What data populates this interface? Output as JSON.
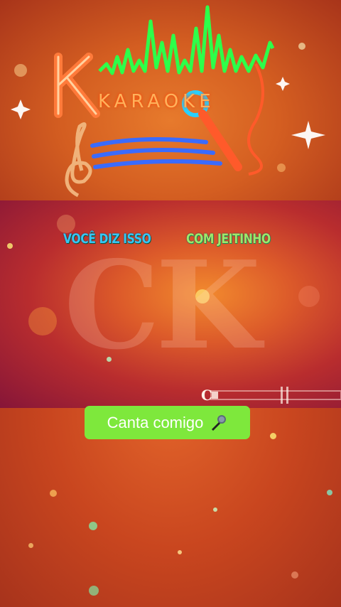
{
  "logo": {
    "title": "KARAOKE",
    "title_color": "#ff5a2a",
    "wave_color": "#2dff4a",
    "staff_color": "#3a6bff"
  },
  "lyrics": {
    "sung": "VOCÊ DIZ ISSO",
    "upcoming": "COM JEITINHO",
    "sung_color": "#37c6f2",
    "upcoming_color": "#9ee86a"
  },
  "watermark": {
    "text": "CK"
  },
  "progress": {
    "fraction": 0.05
  },
  "cta": {
    "label": "Canta comigo",
    "icon": "microphone-icon",
    "background": "#7ee83c"
  }
}
